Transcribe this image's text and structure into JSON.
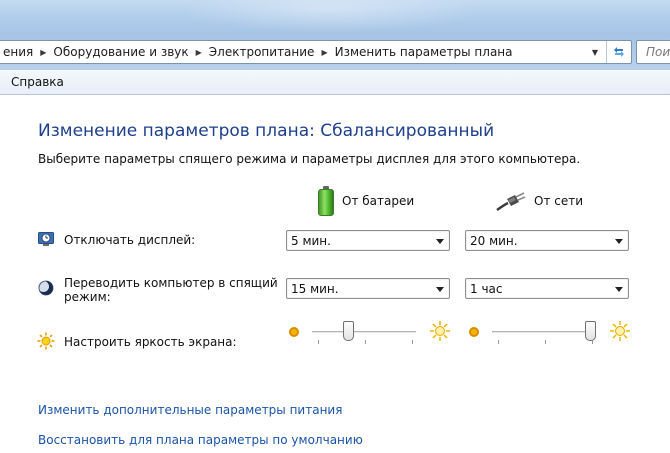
{
  "breadcrumb": {
    "items": [
      "ения",
      "Оборудование и звук",
      "Электропитание",
      "Изменить параметры плана"
    ],
    "search_placeholder": "Поис"
  },
  "menu": {
    "items": [
      "Справка"
    ]
  },
  "page": {
    "title": "Изменение параметров плана: Сбалансированный",
    "subtitle": "Выберите параметры спящего режима и параметры дисплея для этого компьютера."
  },
  "columns": {
    "battery": "От батареи",
    "ac": "От сети"
  },
  "settings": {
    "display_off": {
      "label": "Отключать дисплей:",
      "battery": "5 мин.",
      "ac": "20 мин."
    },
    "sleep": {
      "label_line1": "Переводить компьютер в спящий",
      "label_line2": "режим:",
      "battery": "15 мин.",
      "ac": "1 час"
    },
    "brightness": {
      "label": "Настроить яркость экрана:",
      "battery_level": 0.33,
      "ac_level": 1.0
    }
  },
  "links": {
    "advanced": "Изменить дополнительные параметры питания",
    "restore": "Восстановить для плана параметры по умолчанию"
  },
  "colors": {
    "title": "#1e3f8c",
    "link": "#1a53a8",
    "glass": "#b3cfec"
  },
  "icons": {
    "refresh": "refresh-icon",
    "display": "display-clock-icon",
    "sleep": "moon-icon",
    "brightness": "sun-icon",
    "battery": "battery-icon",
    "plug": "power-plug-icon"
  }
}
